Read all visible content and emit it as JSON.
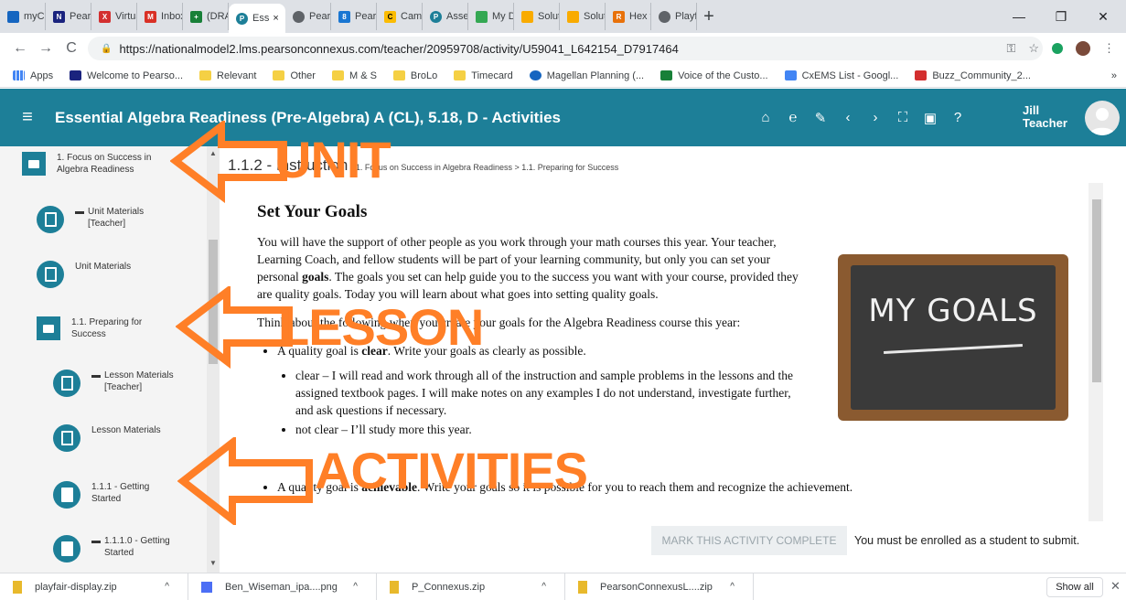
{
  "browser": {
    "tabs": [
      {
        "label": "myClo",
        "color": "#1565c0"
      },
      {
        "label": "Pearso",
        "color": "#1a237e"
      },
      {
        "label": "Virtual",
        "color": "#d32f2f"
      },
      {
        "label": "Inbox",
        "color": "#d93025"
      },
      {
        "label": "(DRAF",
        "color": "#188038"
      },
      {
        "label": "Ess",
        "color": "#1d7f98",
        "active": true
      },
      {
        "label": "Pearso",
        "color": "#5f6368"
      },
      {
        "label": "Pearso",
        "color": "#1976d2"
      },
      {
        "label": "Camp",
        "color": "#fbbc04"
      },
      {
        "label": "Assets",
        "color": "#1d7f98"
      },
      {
        "label": "My Dr",
        "color": "#34a853"
      },
      {
        "label": "Solutic",
        "color": "#f9ab00"
      },
      {
        "label": "Solutic",
        "color": "#f9ab00"
      },
      {
        "label": "Hex to",
        "color": "#e8710a"
      },
      {
        "label": "Playfa",
        "color": "#5f6368"
      }
    ],
    "tab_close": "×",
    "new_tab": "+",
    "minimize": "—",
    "restore": "❐",
    "close_window": "✕",
    "back": "←",
    "forward": "→",
    "reload": "C",
    "url": "https://nationalmodel2.lms.pearsonconnexus.com/teacher/20959708/activity/U59041_L642154_D7917464",
    "key_icon": "⚿",
    "star_icon": "☆",
    "menu_icon": "⋮",
    "bookmarks": [
      {
        "label": "Apps",
        "kind": "apps"
      },
      {
        "label": "Welcome to Pearso...",
        "kind": "site"
      },
      {
        "label": "Relevant",
        "kind": "folder"
      },
      {
        "label": "Other",
        "kind": "folder"
      },
      {
        "label": "M & S",
        "kind": "folder"
      },
      {
        "label": "BroLo",
        "kind": "folder"
      },
      {
        "label": "Timecard",
        "kind": "folder"
      },
      {
        "label": "Magellan Planning (...",
        "kind": "site"
      },
      {
        "label": "Voice of the Custo...",
        "kind": "site"
      },
      {
        "label": "CxEMS List - Googl...",
        "kind": "site"
      },
      {
        "label": "Buzz_Community_2...",
        "kind": "pdf"
      }
    ],
    "bookmarks_more": "»"
  },
  "header": {
    "menu_icon": "≡",
    "title": "Essential Algebra Readiness (Pre-Algebra) A (CL), 5.18, D - Activities",
    "icons": [
      "⌂",
      "℮",
      "✎",
      "‹",
      "›",
      "⛶",
      "▣",
      "?"
    ],
    "user_first": "Jill",
    "user_role": "Teacher"
  },
  "sidebar": {
    "items": [
      {
        "label": "1. Focus on Success in Algebra Readiness",
        "type": "folder",
        "locked": false
      },
      {
        "label": "Unit Materials [Teacher]",
        "type": "doc",
        "locked": true
      },
      {
        "label": "Unit Materials",
        "type": "doc",
        "locked": false
      },
      {
        "label": "1.1. Preparing for Success",
        "type": "folder",
        "locked": false
      },
      {
        "label": "Lesson Materials [Teacher]",
        "type": "doc",
        "locked": true
      },
      {
        "label": "Lesson Materials",
        "type": "doc",
        "locked": false
      },
      {
        "label": "1.1.1 - Getting Started",
        "type": "activity",
        "locked": false
      },
      {
        "label": "1.1.1.0 - Getting Started",
        "type": "activity",
        "locked": true
      }
    ]
  },
  "content": {
    "activity_code": "1.1.2 - Instruction",
    "breadcrumb": "1. Focus on Success in Algebra Readiness > 1.1. Preparing for Success",
    "heading": "Set Your Goals",
    "para1_a": "You will have the support of other people as you work through your math courses this year. Your teacher, Learning Coach, and fellow students will be part of your learning community, but only you can set your personal ",
    "para1_b": "goals",
    "para1_c": ". The goals you set can help guide you to the success you want with your course, provided they are quality goals. Today you will learn about what goes into setting quality goals.",
    "para2": "Think about the following when you create your goals for the Algebra Readiness course this year:",
    "bullet1_a": "A quality goal is ",
    "bullet1_b": "clear",
    "bullet1_c": ". Write your goals as clearly as possible.",
    "sub1": "clear – I will read and work through all of the instruction and sample problems in the lessons and the assigned textbook pages. I will make notes on any examples I do not understand, investigate further, and ask questions if necessary.",
    "sub2": "not clear – I’ll study more this year.",
    "bullet2_a": "A quality goal is ",
    "bullet2_b": "achievable",
    "bullet2_c": ". Write your goals so it is possible for you to reach them and recognize the achievement.",
    "image_text": "MY GOALS",
    "mark_button": "MARK THIS ACTIVITY COMPLETE",
    "mark_note": "You must be enrolled as a student to submit."
  },
  "annotations": {
    "unit": "UNIT",
    "lesson": "LESSON",
    "activities": "ACTIVITIES",
    "color": "#ff7f27"
  },
  "downloads": {
    "items": [
      {
        "name": "playfair-display.zip",
        "kind": "zip"
      },
      {
        "name": "Ben_Wiseman_ipa....png",
        "kind": "png"
      },
      {
        "name": "P_Connexus.zip",
        "kind": "zip"
      },
      {
        "name": "PearsonConnexusL....zip",
        "kind": "zip"
      }
    ],
    "chevron": "^",
    "show_all": "Show all",
    "close": "✕"
  }
}
